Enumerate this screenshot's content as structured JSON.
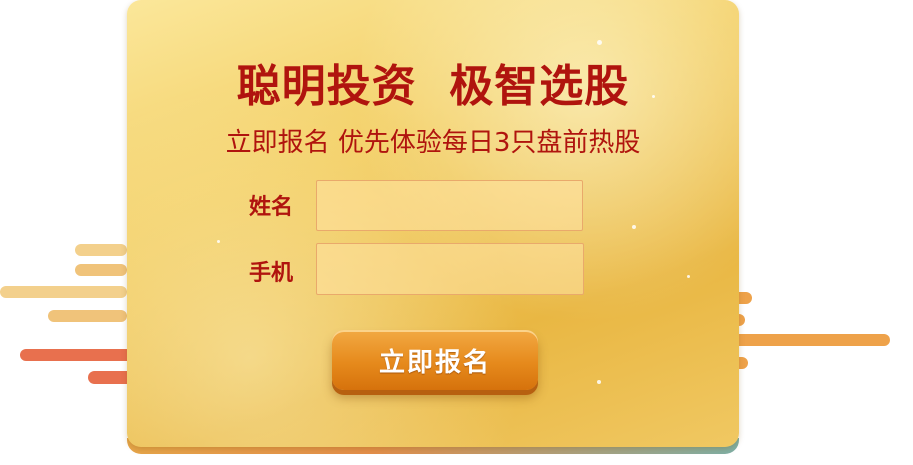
{
  "headline": "聪明投资  极智选股",
  "subheadline": "立即报名 优先体验每日3只盘前热股",
  "form": {
    "name_label": "姓名",
    "name_value": "",
    "phone_label": "手机",
    "phone_value": "",
    "submit_label": "立即报名"
  },
  "colors": {
    "accent_red": "#b0140e",
    "button_orange": "#e68a1c",
    "card_gold": "#f3cf66"
  }
}
